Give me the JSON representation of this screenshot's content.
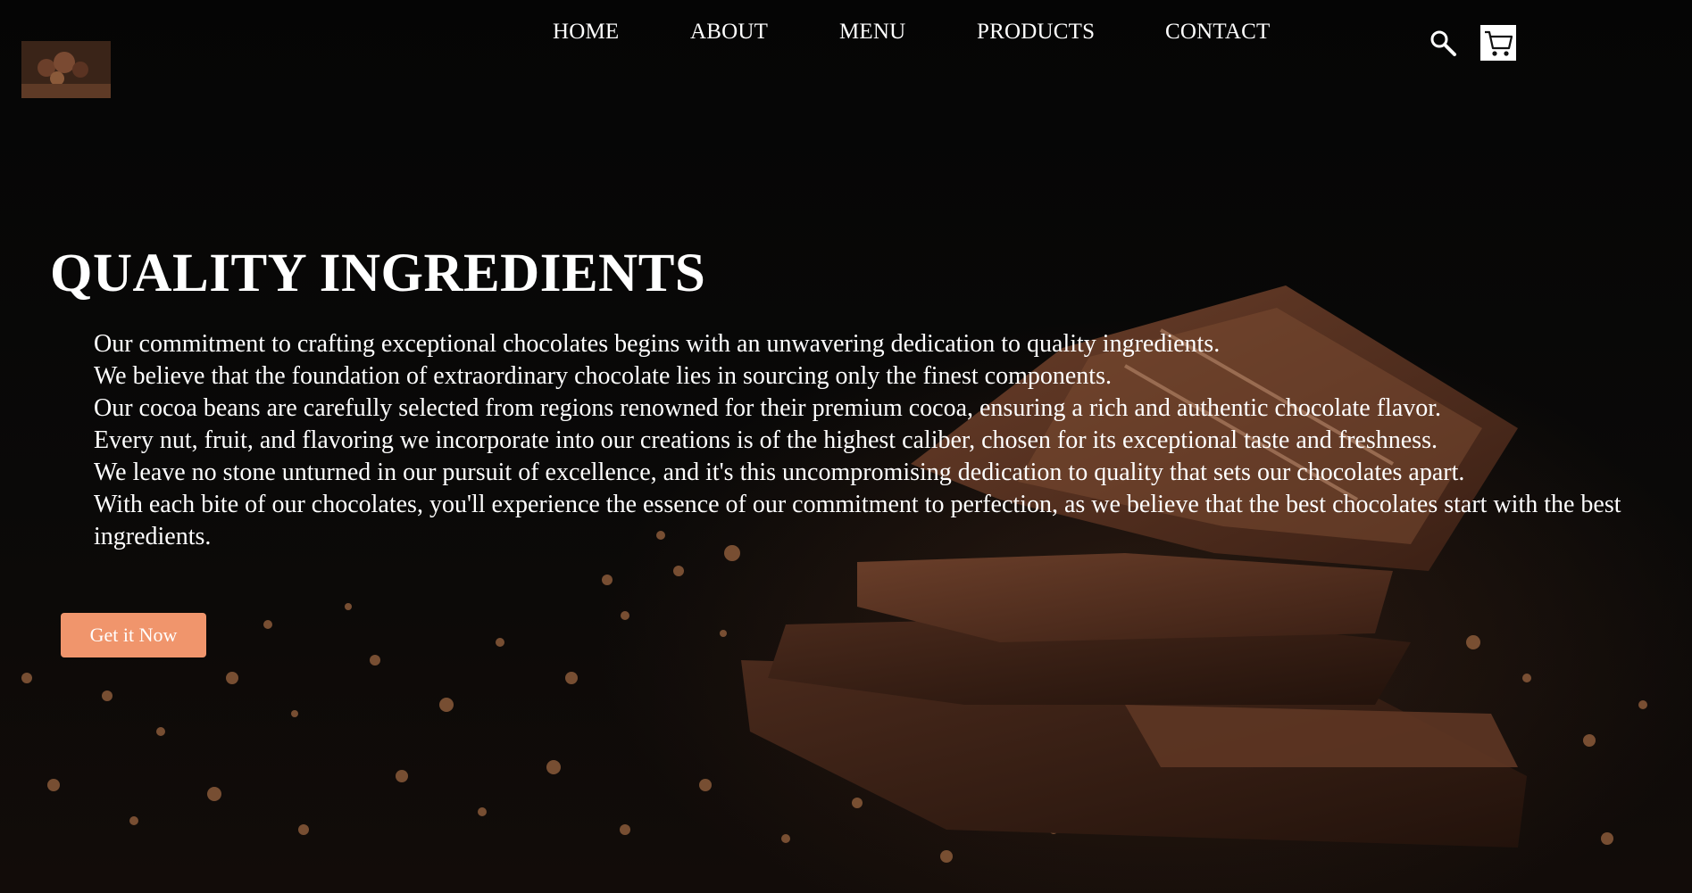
{
  "nav": {
    "items": [
      {
        "label": "HOME"
      },
      {
        "label": "ABOUT"
      },
      {
        "label": "MENU"
      },
      {
        "label": "PRODUCTS"
      },
      {
        "label": "CONTACT"
      }
    ]
  },
  "icons": {
    "search": "search-icon",
    "cart": "cart-icon",
    "logo": "chocolate-logo"
  },
  "hero": {
    "title": "QUALITY INGREDIENTS",
    "lines": [
      "Our commitment to crafting exceptional chocolates begins with an unwavering dedication to quality ingredients.",
      "We believe that the foundation of extraordinary chocolate lies in sourcing only the finest components.",
      "Our cocoa beans are carefully selected from regions renowned for their premium cocoa, ensuring a rich and authentic chocolate flavor.",
      "Every nut, fruit, and flavoring we incorporate into our creations is of the highest caliber, chosen for its exceptional taste and freshness.",
      "We leave no stone unturned in our pursuit of excellence, and it's this uncompromising dedication to quality that sets our chocolates apart.",
      "With each bite of our chocolates, you'll experience the essence of our commitment to perfection, as we believe that the best chocolates start with the best ingredients."
    ],
    "cta_label": "Get it Now"
  },
  "colors": {
    "background": "#000000",
    "cta": "#f0956c",
    "text": "#ffffff"
  }
}
